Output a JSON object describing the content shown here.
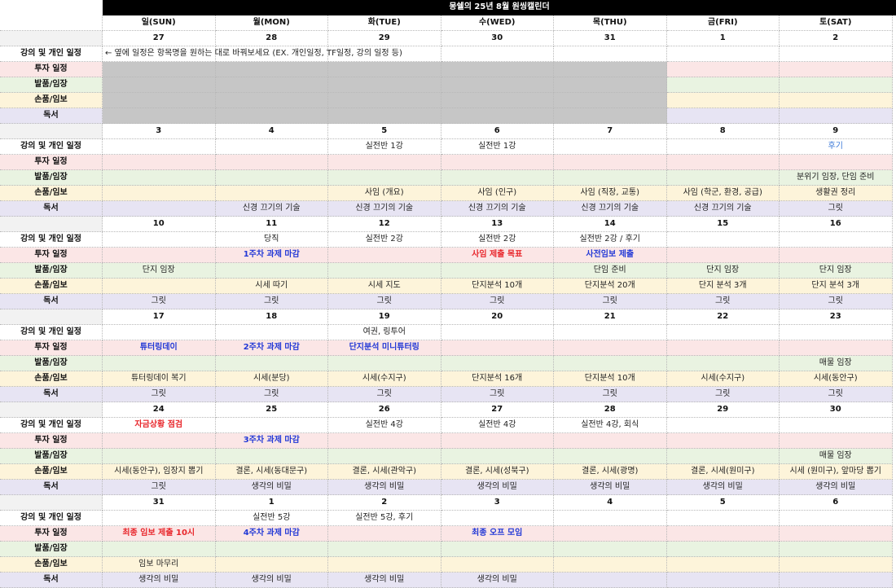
{
  "title": "몽쉘의 25년 8월 원씽캘린더",
  "days": [
    "일(SUN)",
    "월(MON)",
    "화(TUE)",
    "수(WED)",
    "목(THU)",
    "금(FRI)",
    "토(SAT)"
  ],
  "labels": [
    "강의 및 개인 일정",
    "투자 일정",
    "발품/임장",
    "손품/임보",
    "독서"
  ],
  "note": "← 옆에 일정은 항목명을 원하는 대로 바꿔보세요 (EX. 개인일정, TF일정, 강의 일정 등)",
  "weeks": [
    {
      "dates": [
        "27",
        "28",
        "29",
        "30",
        "31",
        "1",
        "2"
      ],
      "rows": [
        [
          "",
          "",
          "",
          "",
          "",
          "",
          ""
        ],
        [
          "",
          "",
          "",
          "",
          "",
          "",
          ""
        ],
        [
          "",
          "",
          "",
          "",
          "",
          "",
          ""
        ],
        [
          "",
          "",
          "",
          "",
          "",
          "",
          ""
        ],
        [
          "",
          "",
          "",
          "",
          "",
          "",
          ""
        ]
      ]
    },
    {
      "dates": [
        "3",
        "4",
        "5",
        "6",
        "7",
        "8",
        "9"
      ],
      "rows": [
        [
          "",
          "",
          "실전반 1강",
          "실전반 1강",
          "",
          "",
          "후기"
        ],
        [
          "",
          "",
          "",
          "",
          "",
          "",
          ""
        ],
        [
          "",
          "",
          "",
          "",
          "",
          "",
          "분위기 임장, 단임 준비"
        ],
        [
          "",
          "",
          "사임 (개요)",
          "사임 (인구)",
          "사임 (직장, 교통)",
          "사임 (학군, 환경, 공급)",
          "생활권 정리"
        ],
        [
          "",
          "신경 끄기의 기술",
          "신경 끄기의 기술",
          "신경 끄기의 기술",
          "신경 끄기의 기술",
          "신경 끄기의 기술",
          "그릿"
        ]
      ]
    },
    {
      "dates": [
        "10",
        "11",
        "12",
        "13",
        "14",
        "15",
        "16"
      ],
      "rows": [
        [
          "",
          "당직",
          "실전반 2강",
          "실전반 2강",
          "실전반 2강 / 후기",
          "",
          ""
        ],
        [
          "",
          "1주차 과제 마감",
          "",
          "사임 제출 목표",
          "사전임보 제출",
          "",
          ""
        ],
        [
          "단지 임장",
          "",
          "",
          "",
          "단임 준비",
          "단지 임장",
          "단지 임장"
        ],
        [
          "",
          "시세 따기",
          "시세 지도",
          "단지분석 10개",
          "단지분석 20개",
          "단지 분석 3개",
          "단지 분석 3개"
        ],
        [
          "그릿",
          "그릿",
          "그릿",
          "그릿",
          "그릿",
          "그릿",
          "그릿"
        ]
      ]
    },
    {
      "dates": [
        "17",
        "18",
        "19",
        "20",
        "21",
        "22",
        "23"
      ],
      "rows": [
        [
          "",
          "",
          "여권, 링투어",
          "",
          "",
          "",
          ""
        ],
        [
          "튜터링데이",
          "2주차 과제 마감",
          "단지분석 미니튜터링",
          "",
          "",
          "",
          ""
        ],
        [
          "",
          "",
          "",
          "",
          "",
          "",
          "매물 임장"
        ],
        [
          "튜터링데이 복기",
          "시세(분당)",
          "시세(수지구)",
          "단지분석 16개",
          "단지분석 10개",
          "시세(수지구)",
          "시세(동안구)"
        ],
        [
          "그릿",
          "그릿",
          "그릿",
          "그릿",
          "그릿",
          "그릿",
          "그릿"
        ]
      ]
    },
    {
      "dates": [
        "24",
        "25",
        "26",
        "27",
        "28",
        "29",
        "30"
      ],
      "rows": [
        [
          "자금상황 점검",
          "",
          "실전반 4강",
          "실전반 4강",
          "실전반 4강, 회식",
          "",
          ""
        ],
        [
          "",
          "3주차 과제 마감",
          "",
          "",
          "",
          "",
          ""
        ],
        [
          "",
          "",
          "",
          "",
          "",
          "",
          "매물 임장"
        ],
        [
          "시세(동안구), 임장지 뽑기",
          "결론, 시세(동대문구)",
          "결론, 시세(관악구)",
          "결론, 시세(성북구)",
          "결론, 시세(광명)",
          "결론, 시세(원미구)",
          "시세 (원미구), 앞마당 뽑기"
        ],
        [
          "그릿",
          "생각의 비밀",
          "생각의 비밀",
          "생각의 비밀",
          "생각의 비밀",
          "생각의 비밀",
          "생각의 비밀"
        ]
      ]
    },
    {
      "dates": [
        "31",
        "1",
        "2",
        "3",
        "4",
        "5",
        "6"
      ],
      "rows": [
        [
          "",
          "실전반 5강",
          "실전반 5강, 후기",
          "",
          "",
          "",
          ""
        ],
        [
          "최종 임보 제출 10시",
          "4주차 과제 마감",
          "",
          "최종 오프 모임",
          "",
          "",
          ""
        ],
        [
          "",
          "",
          "",
          "",
          "",
          "",
          ""
        ],
        [
          "임보 마무리",
          "",
          "",
          "",
          "",
          "",
          ""
        ],
        [
          "생각의 비밀",
          "생각의 비밀",
          "생각의 비밀",
          "생각의 비밀",
          "",
          "",
          ""
        ]
      ]
    }
  ],
  "colors": {
    "sunday": "#e8262b",
    "saturday": "#2339d6",
    "header_bg": "#000000",
    "grey_block": "#c6c6c6",
    "invest_bg": "#fbe6e6",
    "balpum_bg": "#e9f3e1",
    "sonpum_bg": "#fdf4da",
    "read_bg": "#e7e4f3"
  }
}
